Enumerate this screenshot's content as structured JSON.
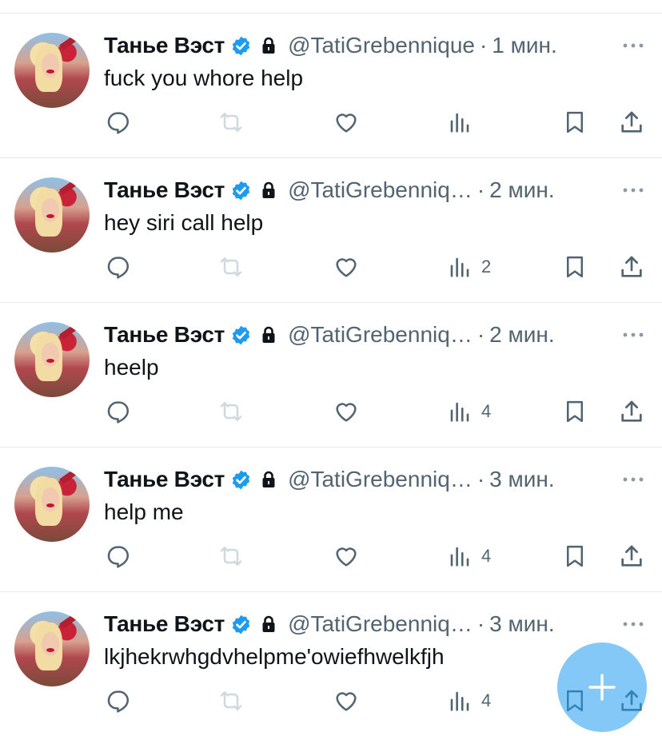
{
  "feed": {
    "tweets": [
      {
        "name": "Танье Вэст",
        "handle": "@TatiGrebennique",
        "separator": "·",
        "time": "1 мин.",
        "text": "fuck you whore help",
        "views": ""
      },
      {
        "name": "Танье Вэст",
        "handle": "@TatiGrebenniq…",
        "separator": "·",
        "time": "2 мин.",
        "text": "hey siri call help",
        "views": "2"
      },
      {
        "name": "Танье Вэст",
        "handle": "@TatiGrebenniq…",
        "separator": "·",
        "time": "2 мин.",
        "text": "heelp",
        "views": "4"
      },
      {
        "name": "Танье Вэст",
        "handle": "@TatiGrebenniq…",
        "separator": "·",
        "time": "3 мин.",
        "text": "help me",
        "views": "4"
      },
      {
        "name": "Танье Вэст",
        "handle": "@TatiGrebenniq…",
        "separator": "·",
        "time": "3 мин.",
        "text": "lkjhekrwhgdvhelpme'owiefhwelkfjh",
        "views": "4"
      }
    ]
  },
  "icons": {
    "verified": "verified-badge-icon",
    "lock": "lock-icon",
    "more": "more-dots-icon",
    "reply": "reply-icon",
    "retweet": "retweet-icon",
    "like": "heart-icon",
    "views": "views-chart-icon",
    "bookmark": "bookmark-icon",
    "share": "share-icon",
    "compose": "plus-icon"
  },
  "colors": {
    "text": "#0f1419",
    "secondary": "#536471",
    "verified": "#1d9bf0",
    "retweet_disabled": "#cfd9de",
    "fab": "#8ecdf8",
    "divider": "#e6e9ec"
  }
}
